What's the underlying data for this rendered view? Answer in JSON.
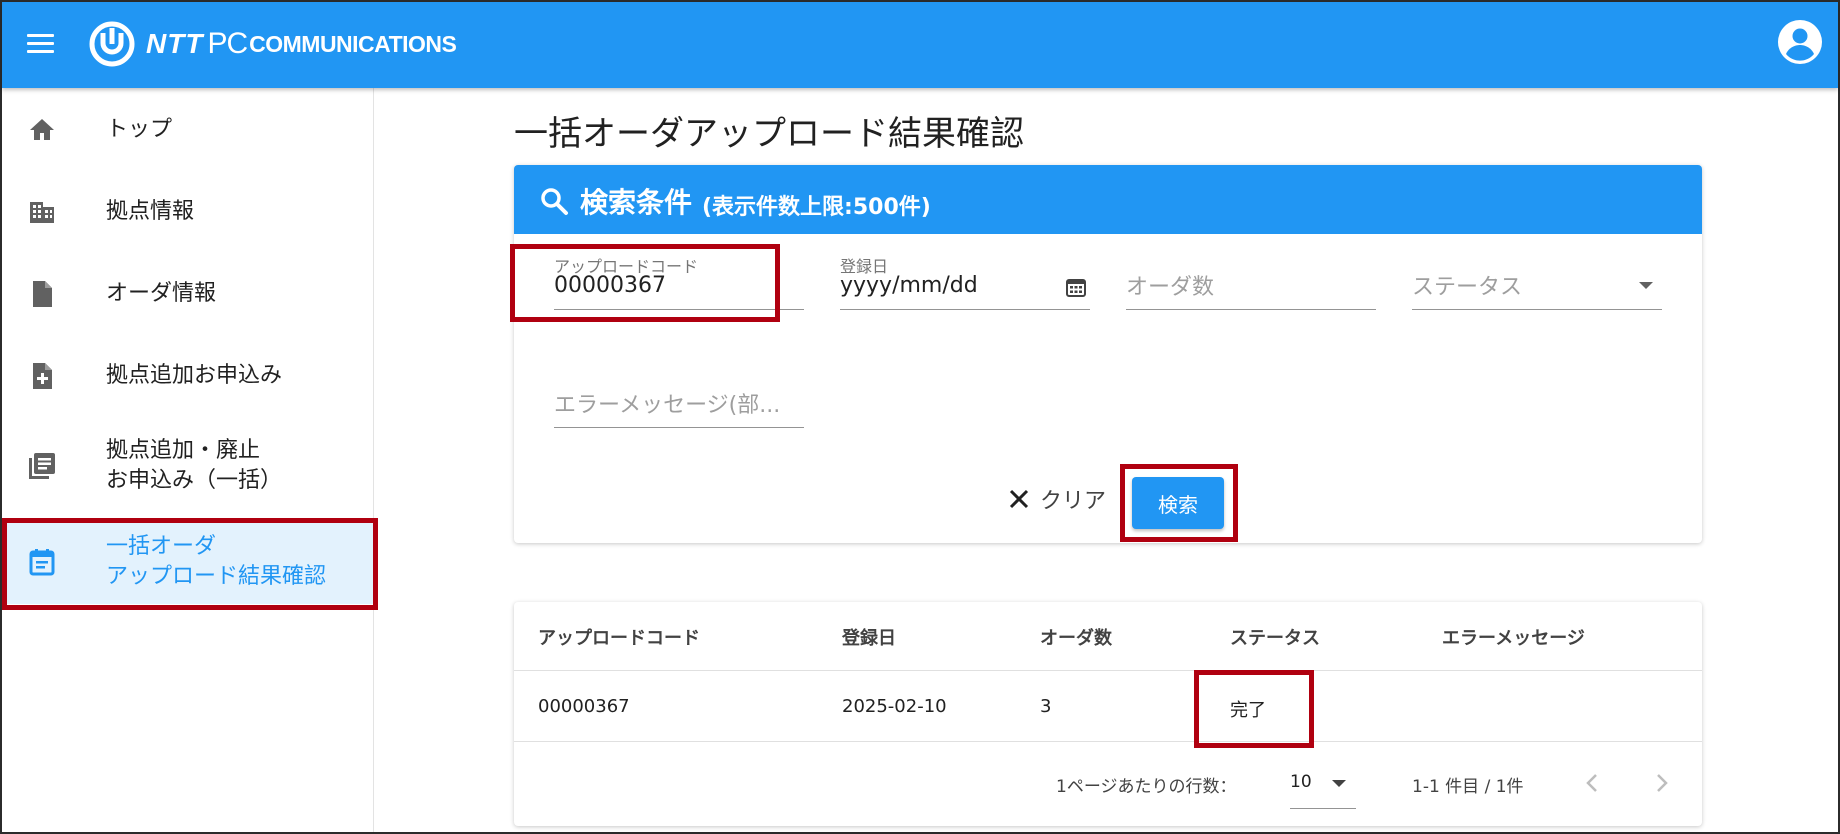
{
  "header": {
    "logo": {
      "ntt": "NTT",
      "pc": "PC",
      "communications": "COMMUNICATIONS"
    },
    "icons": {
      "menu": "menu-icon",
      "account": "account-circle-icon"
    },
    "colors": {
      "primary": "#2196f3",
      "highlight": "#b00010"
    }
  },
  "sidebar": {
    "items": [
      {
        "label": "トップ",
        "icon": "home-icon"
      },
      {
        "label": "拠点情報",
        "icon": "building-icon"
      },
      {
        "label": "オーダ情報",
        "icon": "document-icon"
      },
      {
        "label": "拠点追加お申込み",
        "icon": "document-add-icon"
      },
      {
        "label": "拠点追加・廃止\nお申込み（一括）",
        "icon": "list-document-icon"
      },
      {
        "label": "一括オーダ\nアップロード結果確認",
        "icon": "calendar-note-icon",
        "active": true
      }
    ]
  },
  "page": {
    "title": "一括オーダアップロード結果確認"
  },
  "search": {
    "title": "検索条件",
    "subtitle": "(表示件数上限:500件)",
    "fields": {
      "upload_code": {
        "label": "アップロードコード",
        "value": "00000367"
      },
      "registered_date": {
        "label": "登録日",
        "value": "yyyy/mm/dd"
      },
      "order_count": {
        "placeholder": "オーダ数"
      },
      "status": {
        "placeholder": "ステータス"
      },
      "error_message": {
        "placeholder": "エラーメッセージ(部..."
      }
    },
    "clear_label": "クリア",
    "search_label": "検索"
  },
  "results": {
    "columns": [
      "アップロードコード",
      "登録日",
      "オーダ数",
      "ステータス",
      "エラーメッセージ"
    ],
    "rows": [
      {
        "upload_code": "00000367",
        "registered_date": "2025-02-10",
        "order_count": "3",
        "status": "完了",
        "error_message": ""
      }
    ],
    "pagination": {
      "rows_per_page_label": "1ページあたりの行数：",
      "rows_per_page": "10",
      "range": "1-1 件目 / 1件"
    }
  }
}
